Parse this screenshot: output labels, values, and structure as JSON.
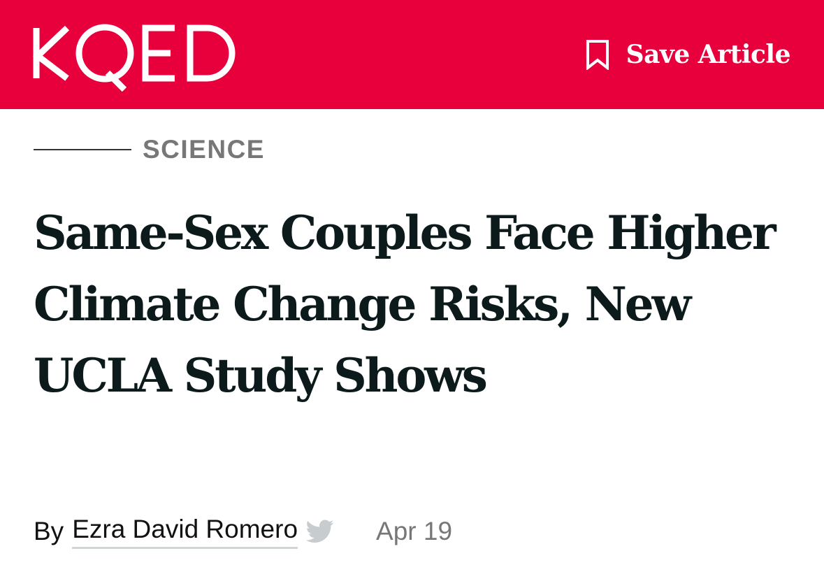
{
  "header": {
    "logo_text": "KQED",
    "save_label": "Save Article",
    "brand_color": "#e8003d"
  },
  "article": {
    "section": "SCIENCE",
    "headline": "Same-Sex Couples Face Higher Climate Change Risks, New UCLA Study Shows",
    "byline_prefix": "By",
    "author": "Ezra David Romero",
    "date": "Apr 19"
  },
  "icons": {
    "save": "bookmark-icon",
    "author_social": "twitter-icon"
  }
}
